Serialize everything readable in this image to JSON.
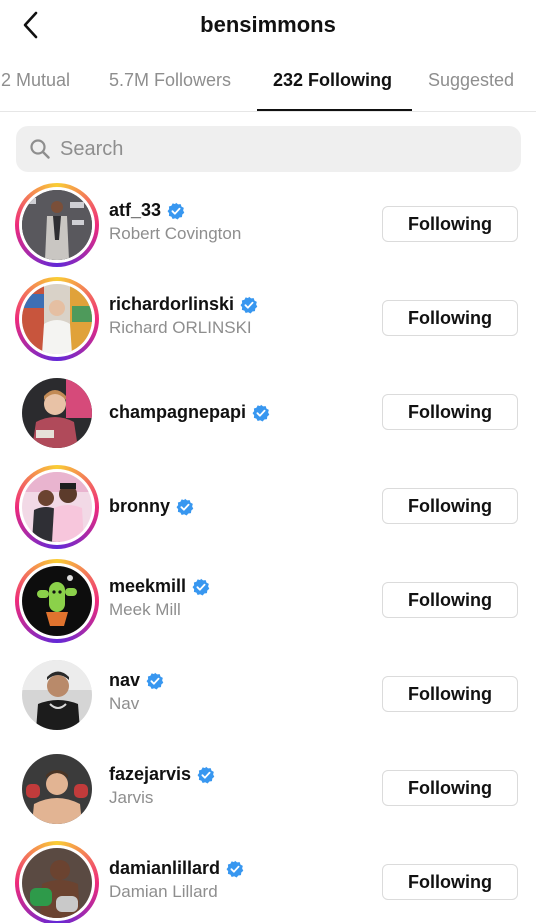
{
  "header": {
    "title": "bensimmons"
  },
  "tabs": [
    {
      "label": "2 Mutual",
      "active": false
    },
    {
      "label": "5.7M Followers",
      "active": false
    },
    {
      "label": "232 Following",
      "active": true
    },
    {
      "label": "Suggested",
      "active": false
    }
  ],
  "search": {
    "placeholder": "Search",
    "value": ""
  },
  "accounts": [
    {
      "username": "atf_33",
      "full_name": "Robert Covington",
      "verified": true,
      "story_ring": true,
      "button_label": "Following"
    },
    {
      "username": "richardorlinski",
      "full_name": "Richard ORLINSKI",
      "verified": true,
      "story_ring": true,
      "button_label": "Following"
    },
    {
      "username": "champagnepapi",
      "full_name": "",
      "verified": true,
      "story_ring": false,
      "button_label": "Following"
    },
    {
      "username": "bronny",
      "full_name": "",
      "verified": true,
      "story_ring": true,
      "button_label": "Following"
    },
    {
      "username": "meekmill",
      "full_name": "Meek Mill",
      "verified": true,
      "story_ring": true,
      "button_label": "Following"
    },
    {
      "username": "nav",
      "full_name": "Nav",
      "verified": true,
      "story_ring": false,
      "button_label": "Following"
    },
    {
      "username": "fazejarvis",
      "full_name": "Jarvis",
      "verified": true,
      "story_ring": false,
      "button_label": "Following"
    },
    {
      "username": "damianlillard",
      "full_name": "Damian Lillard",
      "verified": true,
      "story_ring": true,
      "button_label": "Following"
    }
  ],
  "colors": {
    "verified_blue": "#3897f0",
    "secondary_text": "#8e8e8e",
    "search_bg": "#efefef"
  },
  "icons": {
    "back": "chevron-left-icon",
    "search": "search-icon",
    "verified": "verified-badge-icon"
  }
}
